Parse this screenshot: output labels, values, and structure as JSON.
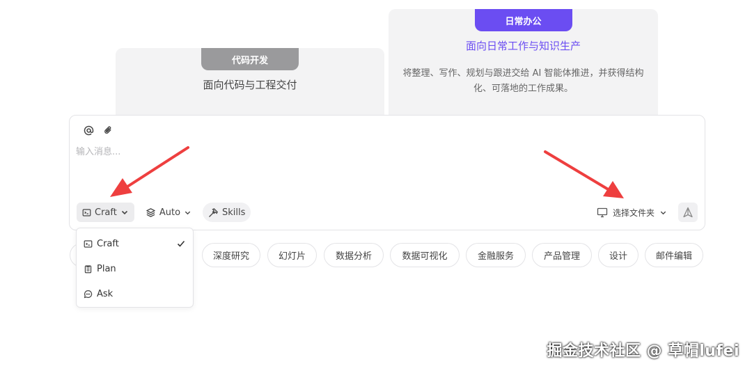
{
  "cards": {
    "code": {
      "tab": "代码开发",
      "title": "面向代码与工程交付"
    },
    "office": {
      "tab": "日常办公",
      "title": "面向日常工作与知识生产",
      "desc": "将整理、写作、规划与跟进交给 AI 智能体推进，并获得结构化、可落地的工作成果。"
    }
  },
  "composer": {
    "placeholder": "输入消息...",
    "mode_label": "Craft",
    "model_label": "Auto",
    "skills_label": "Skills",
    "folder_label": "选择文件夹"
  },
  "dropdown": {
    "items": [
      {
        "label": "Craft",
        "icon": "craft-icon",
        "selected": true
      },
      {
        "label": "Plan",
        "icon": "clipboard-icon",
        "selected": false
      },
      {
        "label": "Ask",
        "icon": "chat-bubble-icon",
        "selected": false
      }
    ]
  },
  "chips": [
    "深度研究",
    "幻灯片",
    "数据分析",
    "数据可视化",
    "金融服务",
    "产品管理",
    "设计",
    "邮件编辑"
  ],
  "watermark": "掘金技术社区 @ 草帽lufei",
  "colors": {
    "accent": "#6b4df2",
    "annotation": "#ee3f3f",
    "tab_gray": "#9a9a9c"
  }
}
